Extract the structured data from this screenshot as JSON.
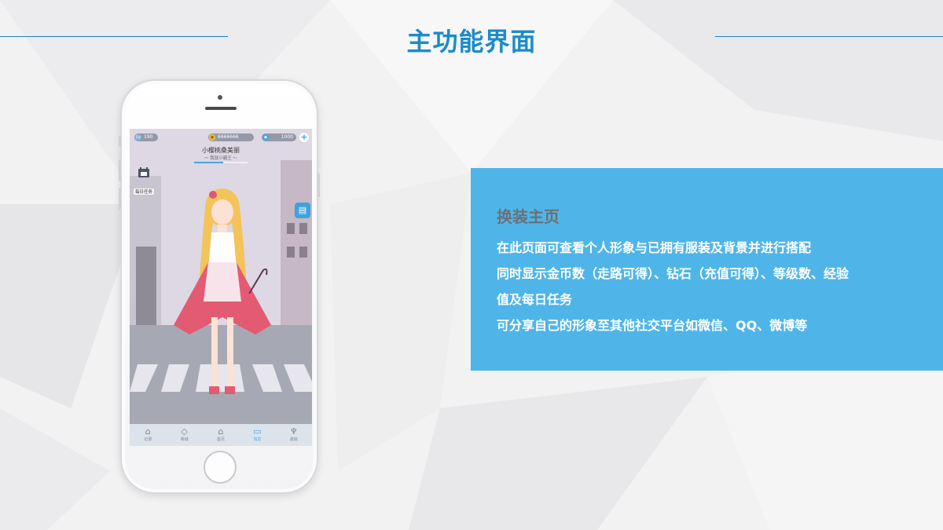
{
  "slide": {
    "title": "主功能界面"
  },
  "phone": {
    "hud": {
      "level": "190",
      "coins": "6666666",
      "diamonds": "1000",
      "plus": "+"
    },
    "character": {
      "name": "小樱桃桑美丽",
      "subtitle": "～ 我就小霸王 ～"
    },
    "side": {
      "daily_label": "每日任务",
      "side_tab_icon": "tshirt-icon"
    },
    "tabs": [
      {
        "label": "记录",
        "icon": "house-icon"
      },
      {
        "label": "商城",
        "icon": "diamond-icon"
      },
      {
        "label": "首页",
        "icon": "home-icon"
      },
      {
        "label": "消息",
        "icon": "chat-icon"
      },
      {
        "label": "成就",
        "icon": "trophy-icon"
      }
    ],
    "exp_fraction": 0.55
  },
  "info": {
    "heading": "换装主页",
    "lines": [
      "在此页面可查看个人形象与已拥有服装及背景并进行搭配",
      "同时显示金币数（走路可得）、钻石（充值可得）、等级数、经验",
      "值及每日任务",
      "可分享自己的形象至其他社交平台如微信、QQ、微博等"
    ]
  },
  "colors": {
    "accent": "#1c8bc9",
    "box": "#4fb5e8",
    "heading": "#6a7178"
  }
}
